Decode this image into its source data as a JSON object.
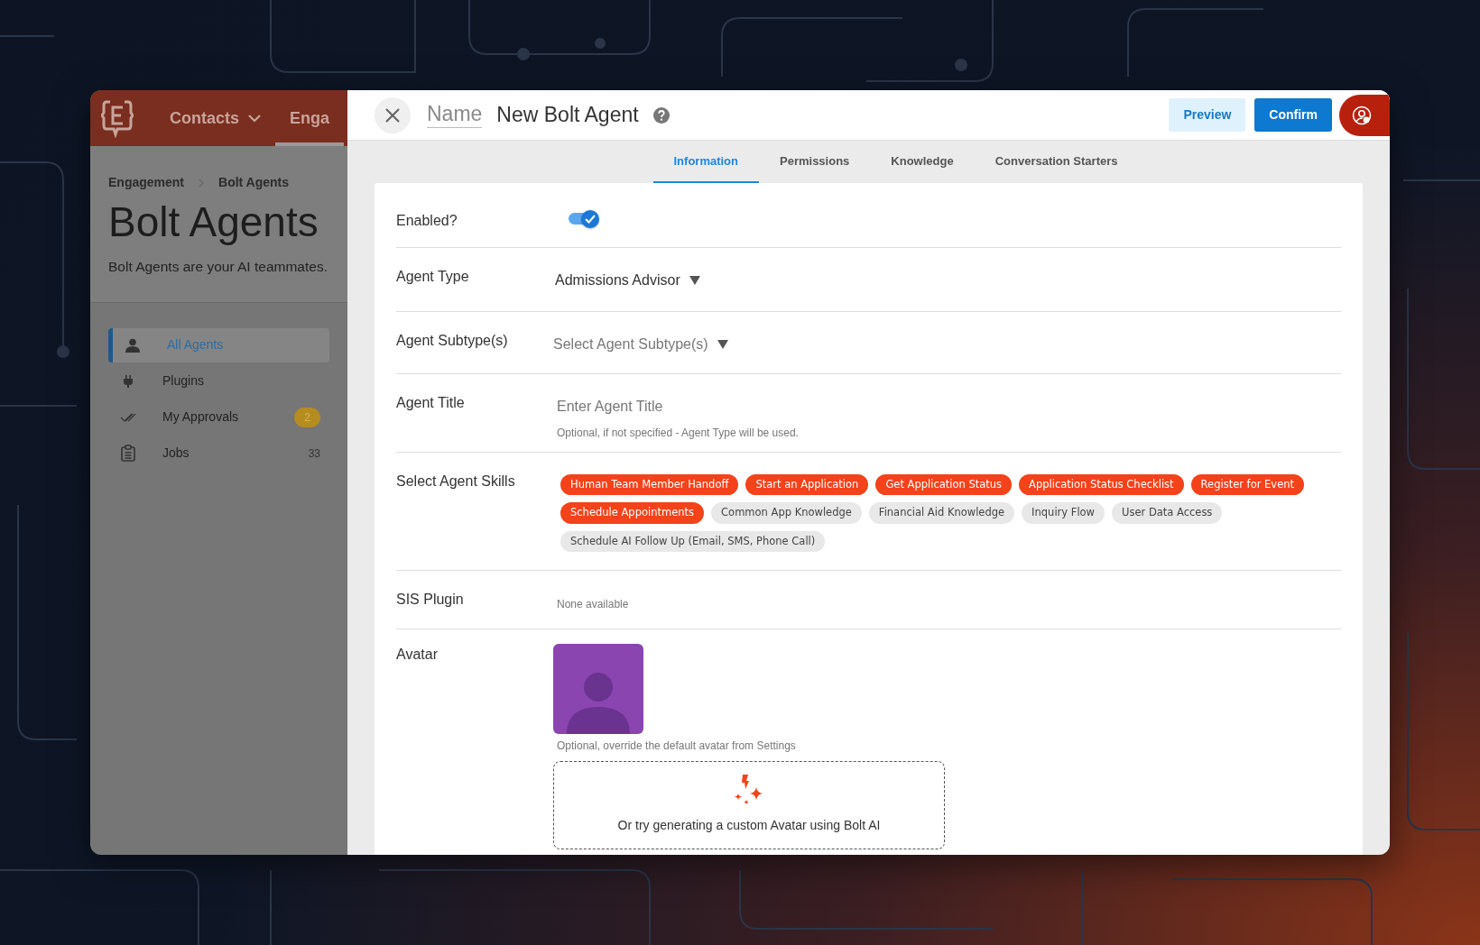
{
  "top_nav": [
    {
      "label": "Contacts",
      "dropdown": true,
      "selected": false
    },
    {
      "label": "Enga",
      "dropdown": false,
      "selected": true
    }
  ],
  "breadcrumb": [
    "Engagement",
    "Bolt Agents"
  ],
  "page_title": "Bolt Agents",
  "page_description": "Bolt Agents are your AI teammates.",
  "sidebar_items": [
    {
      "label": "All Agents",
      "kind": "person",
      "selected": true
    },
    {
      "label": "Plugins",
      "kind": "plug",
      "selected": false
    },
    {
      "label": "My Approvals",
      "kind": "checks",
      "selected": false,
      "badge": "2"
    },
    {
      "label": "Jobs",
      "kind": "clipboard",
      "selected": false,
      "count": "33"
    }
  ],
  "editor": {
    "name_label": "Name",
    "name_value": "New Bolt Agent",
    "buttons": [
      {
        "label": "Preview",
        "kind": "secondary"
      },
      {
        "label": "Confirm",
        "kind": "primary"
      }
    ]
  },
  "tabs": [
    {
      "label": "Information",
      "selected": true
    },
    {
      "label": "Permissions",
      "selected": false
    },
    {
      "label": "Knowledge",
      "selected": false
    },
    {
      "label": "Conversation Starters",
      "selected": false
    }
  ],
  "form": {
    "enabled": {
      "label": "Enabled?",
      "on": true
    },
    "agent_type": {
      "label": "Agent Type",
      "value": "Admissions Advisor"
    },
    "agent_subtypes": {
      "label": "Agent Subtype(s)",
      "placeholder": "Select Agent Subtype(s)"
    },
    "agent_title": {
      "label": "Agent Title",
      "placeholder": "Enter Agent Title",
      "help": "Optional, if not specified - Agent Type will be used."
    },
    "skills": {
      "label": "Select Agent Skills",
      "items": [
        {
          "label": "Human Team Member Handoff",
          "selected": true
        },
        {
          "label": "Start an Application",
          "selected": true
        },
        {
          "label": "Get Application Status",
          "selected": true
        },
        {
          "label": "Application Status Checklist",
          "selected": true
        },
        {
          "label": "Register for Event",
          "selected": true
        },
        {
          "label": "Schedule Appointments",
          "selected": true
        },
        {
          "label": "Common App Knowledge",
          "selected": false
        },
        {
          "label": "Financial Aid Knowledge",
          "selected": false
        },
        {
          "label": "Inquiry Flow",
          "selected": false
        },
        {
          "label": "User Data Access",
          "selected": false
        },
        {
          "label": "Schedule AI Follow Up (Email, SMS, Phone Call)",
          "selected": false
        }
      ]
    },
    "sis_plugin": {
      "label": "SIS Plugin",
      "value": "None available"
    },
    "avatar": {
      "label": "Avatar",
      "help": "Optional, override the default avatar from Settings",
      "generate_text": "Or try generating a custom Avatar using Bolt AI"
    }
  }
}
